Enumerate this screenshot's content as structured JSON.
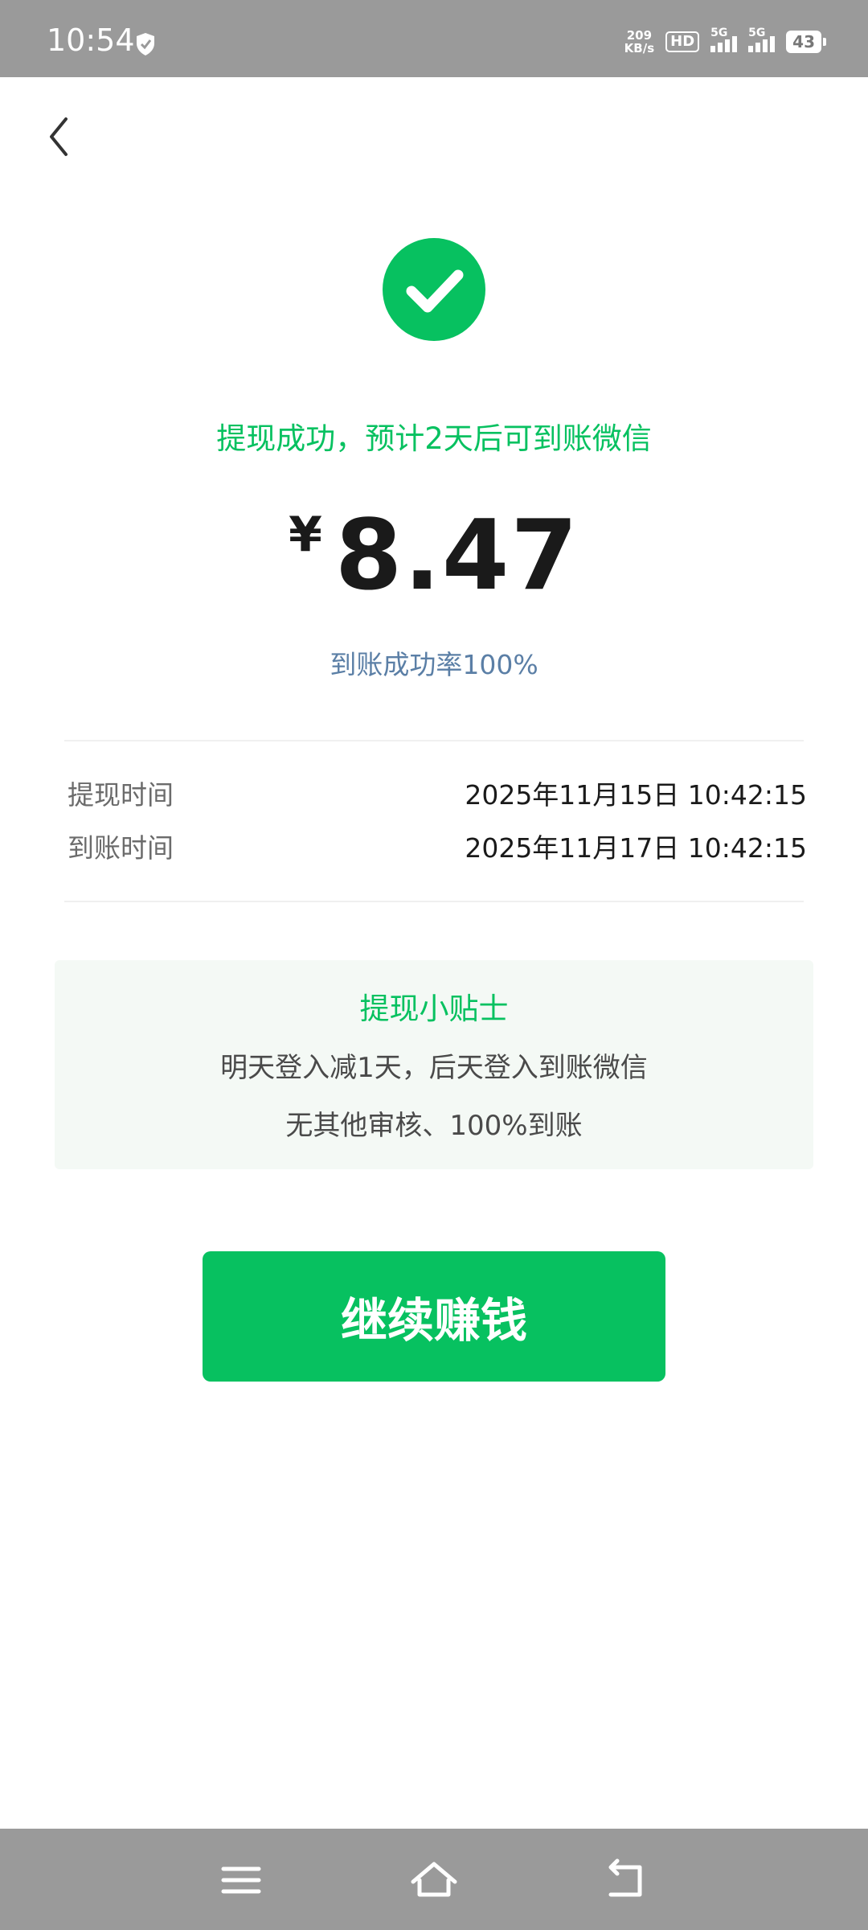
{
  "status_bar": {
    "time": "10:54",
    "net_speed_value": "209",
    "net_speed_unit": "KB/s",
    "hd_label": "HD",
    "sim1_label": "5G",
    "sim2_label": "5G",
    "battery": "43"
  },
  "header": {
    "back_icon": "chevron-left-icon"
  },
  "result": {
    "icon": "check-circle-icon",
    "status_text": "提现成功，预计2天后可到账微信",
    "currency_symbol": "¥",
    "amount": "8.47",
    "success_rate": "到账成功率100%"
  },
  "details": [
    {
      "label": "提现时间",
      "value": "2025年11月15日 10:42:15"
    },
    {
      "label": "到账时间",
      "value": "2025年11月17日 10:42:15"
    }
  ],
  "tips": {
    "title": "提现小贴士",
    "lines": [
      "明天登入减1天，后天登入到账微信",
      "无其他审核、100%到账"
    ]
  },
  "action": {
    "continue_label": "继续赚钱"
  },
  "nav": {
    "menu_icon": "menu-icon",
    "home_icon": "home-icon",
    "back_icon": "back-icon"
  },
  "colors": {
    "accent": "#07c160",
    "rate_text": "#5b7fa6",
    "tips_bg": "#f4f9f5"
  }
}
